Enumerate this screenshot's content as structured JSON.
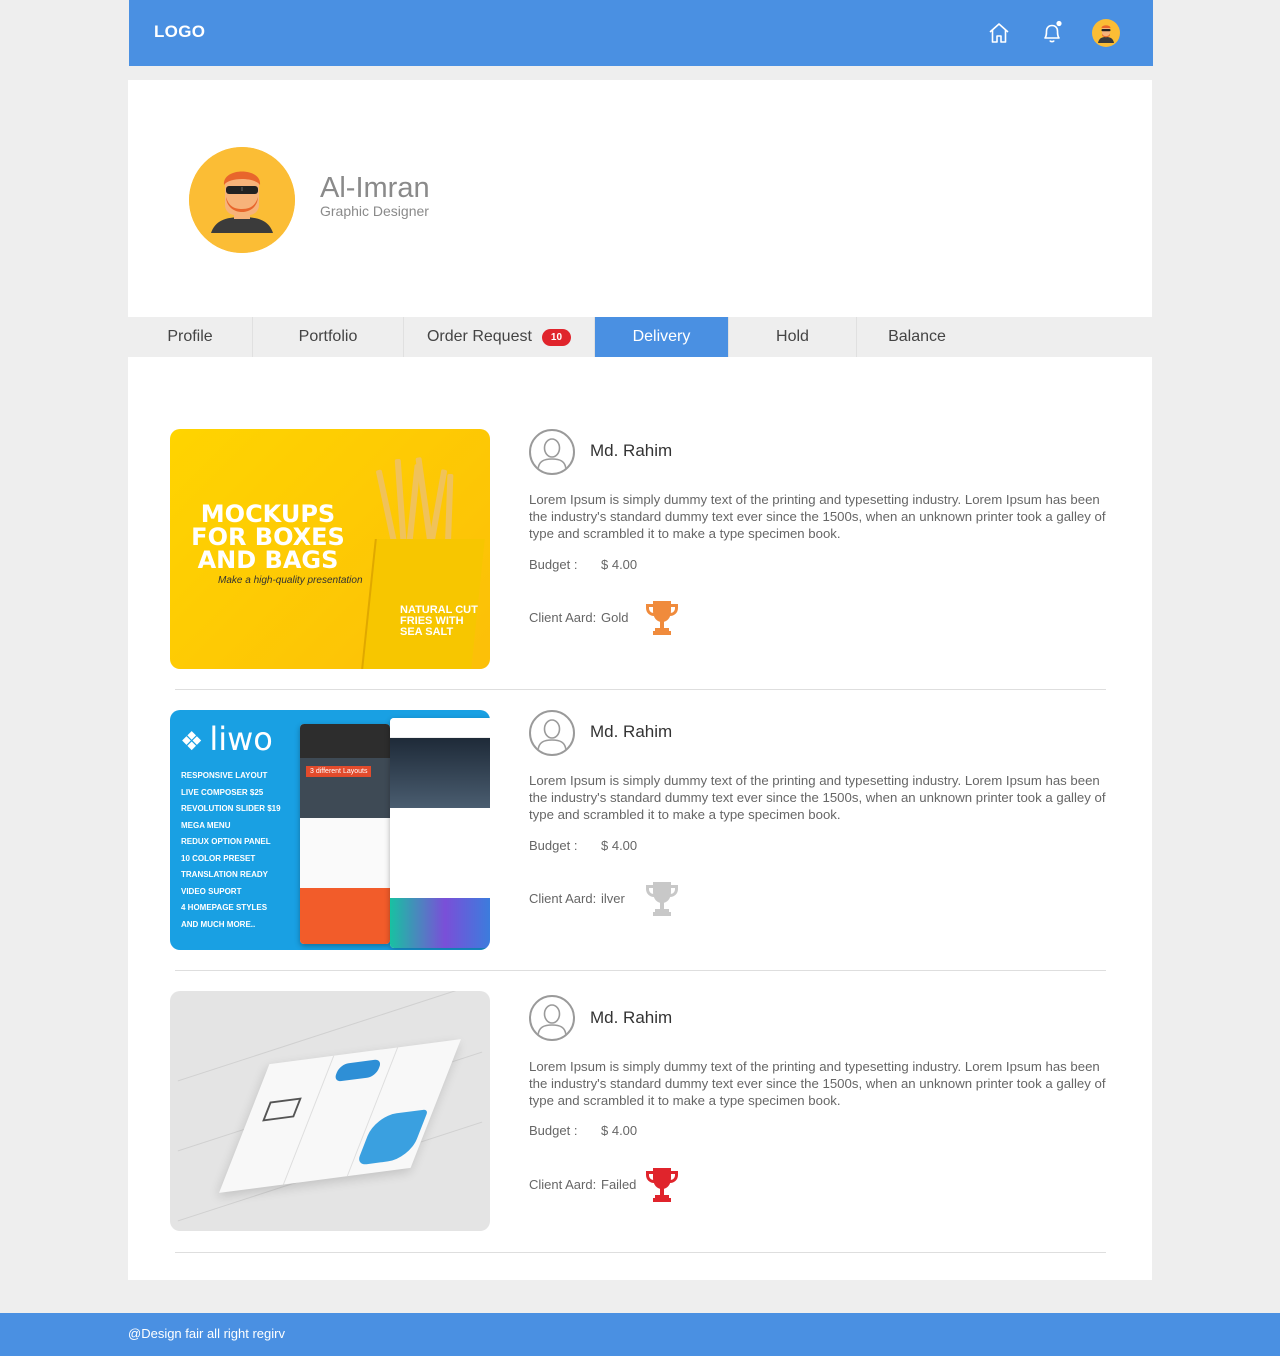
{
  "header": {
    "logo": "LOGO",
    "icons": [
      "home-icon",
      "bell-icon",
      "user-avatar-icon"
    ],
    "color": "#4a90e2"
  },
  "profile": {
    "name": "Al-Imran",
    "role": "Graphic Designer"
  },
  "tabs": [
    {
      "label": "Profile"
    },
    {
      "label": "Portfolio"
    },
    {
      "label": "Order Request",
      "badge": "10"
    },
    {
      "label": "Delivery",
      "active": true
    },
    {
      "label": "Hold"
    },
    {
      "label": "Balance"
    }
  ],
  "deliveries": [
    {
      "thumbnail": {
        "headline": "MOCKUPS FOR BOXES AND BAGS",
        "subline": "Make a high-quality presentation",
        "box_text": "NATURAL CUT FRIES WITH SEA SALT"
      },
      "client": "Md. Rahim",
      "description": "Lorem Ipsum is simply dummy text of the printing and typesetting industry. Lorem Ipsum has been the industry's standard dummy text ever since the 1500s, when an unknown printer took a galley of type and scrambled it to make a type specimen book.",
      "budget_label": "Budget :",
      "budget_value": "$ 4.00",
      "award_label": "Client Aard:",
      "award_value": "Gold",
      "trophy_color": "#f08b3c"
    },
    {
      "thumbnail": {
        "brand": "liwo",
        "features": "RESPONSIVE LAYOUT\nLIVE COMPOSER $25\nREVOLUTION SLIDER $19\nMEGA MENU\nREDUX OPTION PANEL\n10 COLOR PRESET\nTRANSLATION READY\nVIDEO SUPORT\n4 HOMEPAGE STYLES\nAND MUCH MORE..",
        "screen_title": "3 different Layouts"
      },
      "client": "Md. Rahim",
      "description": "Lorem Ipsum is simply dummy text of the printing and typesetting industry. Lorem Ipsum has been the industry's standard dummy text ever since the 1500s, when an unknown printer took a galley of type and scrambled it to make a type specimen book.",
      "budget_label": "Budget :",
      "budget_value": "$ 4.00",
      "award_label": "Client Aard:",
      "award_value": "ilver",
      "trophy_color": "#c8c8c8"
    },
    {
      "thumbnail": {},
      "client": "Md. Rahim",
      "description": "Lorem Ipsum is simply dummy text of the printing and typesetting industry. Lorem Ipsum has been the industry's standard dummy text ever since the 1500s, when an unknown printer took a galley of type and scrambled it to make a type specimen book.",
      "budget_label": "Budget :",
      "budget_value": "$ 4.00",
      "award_label": "Client Aard:",
      "award_value": "Failed",
      "trophy_color": "#e0242c"
    }
  ],
  "footer": {
    "text": "@Design fair all right regirv"
  }
}
